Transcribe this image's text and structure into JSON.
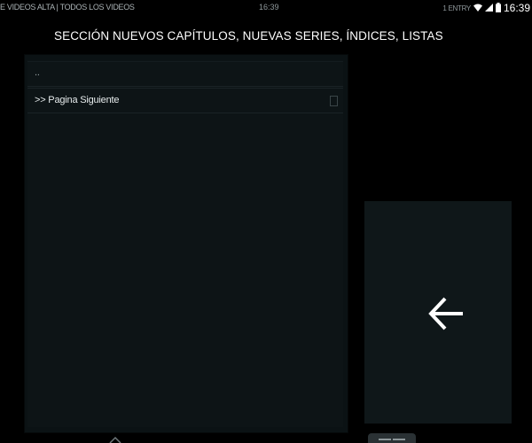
{
  "status_bar": {
    "left_text": "E VIDEOS ALTA | TODOS LOS VIDEOS",
    "center_time": "16:39",
    "right_ghost": "1 ENTRY",
    "clock": "16:39",
    "icons": [
      "wifi-icon",
      "signal-icon",
      "battery-icon"
    ]
  },
  "header": {
    "title": "SECCIÓN NUEVOS CAPÍTULOS, NUEVAS SERIES, ÍNDICES, LISTAS"
  },
  "list": {
    "items": [
      {
        "label": "..",
        "kind": "parent"
      },
      {
        "label": ">> Pagina Siguiente",
        "kind": "next-page"
      }
    ]
  },
  "back_panel": {
    "icon": "back-arrow-icon"
  },
  "colors": {
    "background": "#000000",
    "panel": "#0d1416",
    "back_panel": "#0f1719",
    "text": "#ffffff"
  }
}
